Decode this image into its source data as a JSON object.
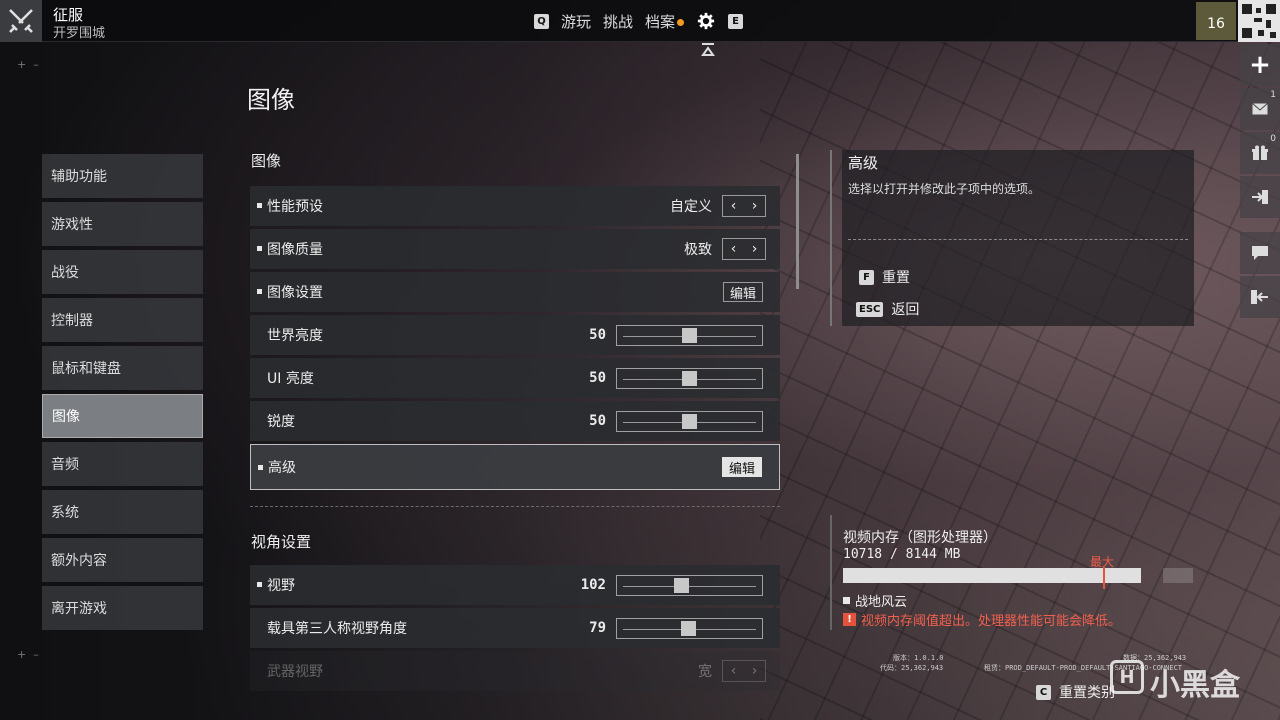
{
  "header": {
    "mode_title": "征服",
    "mode_subtitle": "开罗围城",
    "nav": {
      "prev_key": "Q",
      "items": [
        "游玩",
        "挑战",
        "档案"
      ],
      "next_key": "E"
    },
    "level": "16"
  },
  "page_title": "图像",
  "sidebar": {
    "items": [
      {
        "label": "辅助功能"
      },
      {
        "label": "游戏性"
      },
      {
        "label": "战役"
      },
      {
        "label": "控制器"
      },
      {
        "label": "鼠标和键盘"
      },
      {
        "label": "图像",
        "active": true
      },
      {
        "label": "音频"
      },
      {
        "label": "系统"
      },
      {
        "label": "额外内容"
      },
      {
        "label": "离开游戏"
      }
    ]
  },
  "settings": {
    "section1": {
      "title": "图像",
      "perf_preset": {
        "label": "性能预设",
        "value": "自定义"
      },
      "image_quality": {
        "label": "图像质量",
        "value": "极致"
      },
      "image_settings": {
        "label": "图像设置",
        "button": "编辑"
      },
      "world_brightness": {
        "label": "世界亮度",
        "value": "50",
        "level": 0.5
      },
      "ui_brightness": {
        "label": "UI 亮度",
        "value": "50",
        "level": 0.5
      },
      "sharpness": {
        "label": "锐度",
        "value": "50",
        "level": 0.5
      },
      "advanced": {
        "label": "高级",
        "button": "编辑"
      }
    },
    "section2": {
      "title": "视角设置",
      "fov": {
        "label": "视野",
        "value": "102",
        "level": 0.44
      },
      "vehicle_fov": {
        "label": "载具第三人称视野角度",
        "value": "79",
        "level": 0.49
      },
      "weapon_fov": {
        "label": "武器视野",
        "value": "宽"
      }
    }
  },
  "info_panel": {
    "title": "高级",
    "description": "选择以打开并修改此子项中的选项。",
    "reset_key": "F",
    "reset_label": "重置",
    "back_key": "ESC",
    "back_label": "返回"
  },
  "dock": {
    "mail_count": "1",
    "gift_count": "0"
  },
  "vram": {
    "title": "视频内存（图形处理器）",
    "usage": "10718 / 8144 MB",
    "max_label": "最大",
    "usage_fraction": 0.85,
    "game": "战地风云",
    "warning": "视频内存阈值超出。处理器性能可能会降低。"
  },
  "build_info": {
    "version": "版本：1.0.1.0",
    "code": "代码：25,362,943",
    "data": "数据：25,362,943",
    "branch": "租赁：PROD_DEFAULT-PROD_DEFAULT-SANTIAGO-CONNECT"
  },
  "footer": {
    "reset_category_key": "C",
    "reset_category_label": "重置类别",
    "watermark": "小黑盒"
  }
}
